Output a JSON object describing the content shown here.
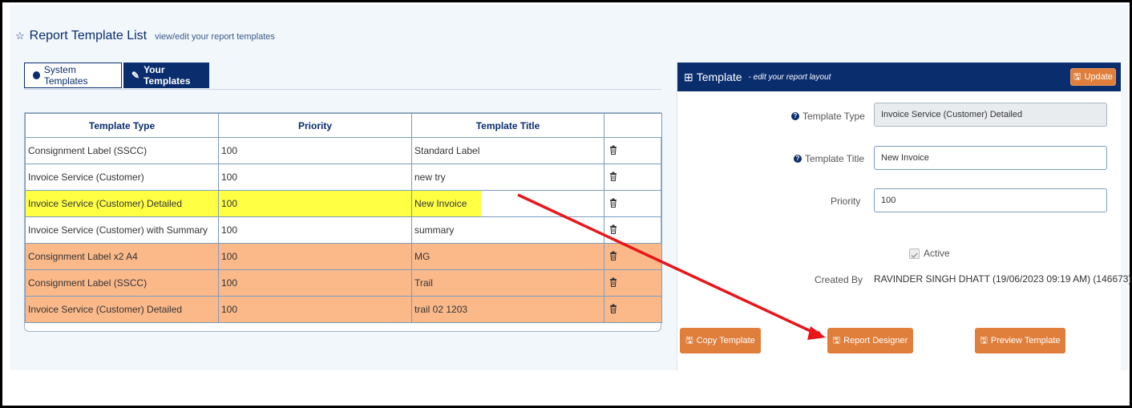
{
  "header": {
    "title": "Report Template List",
    "subtitle": "view/edit your report templates"
  },
  "tabs": [
    {
      "label": "System Templates"
    },
    {
      "label": "Your Templates"
    }
  ],
  "table": {
    "columns": [
      "Template Type",
      "Priority",
      "Template Title"
    ],
    "rows": [
      {
        "type": "Consignment Label (SSCC)",
        "priority": "100",
        "title": "Standard Label"
      },
      {
        "type": "Invoice Service (Customer)",
        "priority": "100",
        "title": "new try"
      },
      {
        "type": "Invoice Service (Customer) Detailed",
        "priority": "100",
        "title": "New Invoice"
      },
      {
        "type": "Invoice Service (Customer) with Summary",
        "priority": "100",
        "title": "summary"
      },
      {
        "type": "Consignment Label x2 A4",
        "priority": "100",
        "title": "MG"
      },
      {
        "type": "Consignment Label (SSCC)",
        "priority": "100",
        "title": "Trail"
      },
      {
        "type": "Invoice Service (Customer) Detailed",
        "priority": "100",
        "title": "trail 02 1203"
      }
    ]
  },
  "panel": {
    "title": "Template",
    "subtitle": "- edit your report layout",
    "update_label": "Update",
    "fields": {
      "type_label": "Template Type",
      "type_value": "Invoice Service (Customer) Detailed",
      "title_label": "Template Title",
      "title_value": "New Invoice",
      "priority_label": "Priority",
      "priority_value": "100",
      "active_label": "Active",
      "created_label": "Created By",
      "created_value": "RAVINDER SINGH DHATT (19/06/2023 09:19 AM) (146673)"
    },
    "buttons": {
      "copy": "Copy Template",
      "designer": "Report Designer",
      "preview": "Preview Template"
    }
  },
  "colors": {
    "navy": "#0a2d6e",
    "orange_button": "#e07f3c",
    "row_highlight_yellow": "#ffff44",
    "row_highlight_orange": "#fbb98a",
    "annotation_arrow": "#e8161b"
  }
}
